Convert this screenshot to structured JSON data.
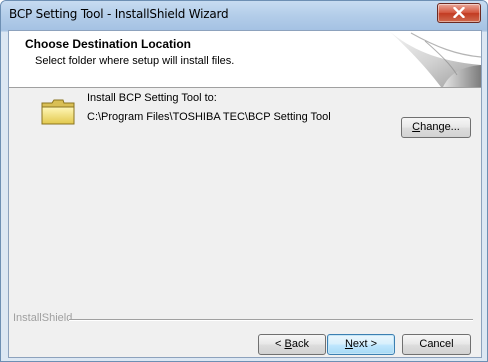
{
  "window": {
    "title": "BCP Setting Tool - InstallShield Wizard"
  },
  "header": {
    "title": "Choose Destination Location",
    "subtitle": "Select folder where setup will install files."
  },
  "destination": {
    "label": "Install BCP Setting Tool to:",
    "path": "C:\\Program Files\\TOSHIBA TEC\\BCP Setting Tool",
    "change_button": {
      "pre": "",
      "accel": "C",
      "post": "hange..."
    }
  },
  "footer": {
    "brand": "InstallShield",
    "back_button": {
      "pre": "< ",
      "accel": "B",
      "post": "ack"
    },
    "next_button": {
      "pre": "",
      "accel": "N",
      "post": "ext >"
    },
    "cancel_button": "Cancel"
  },
  "icons": {
    "close": "close-icon",
    "folder": "folder-icon",
    "header_art": "page-curl-art"
  }
}
